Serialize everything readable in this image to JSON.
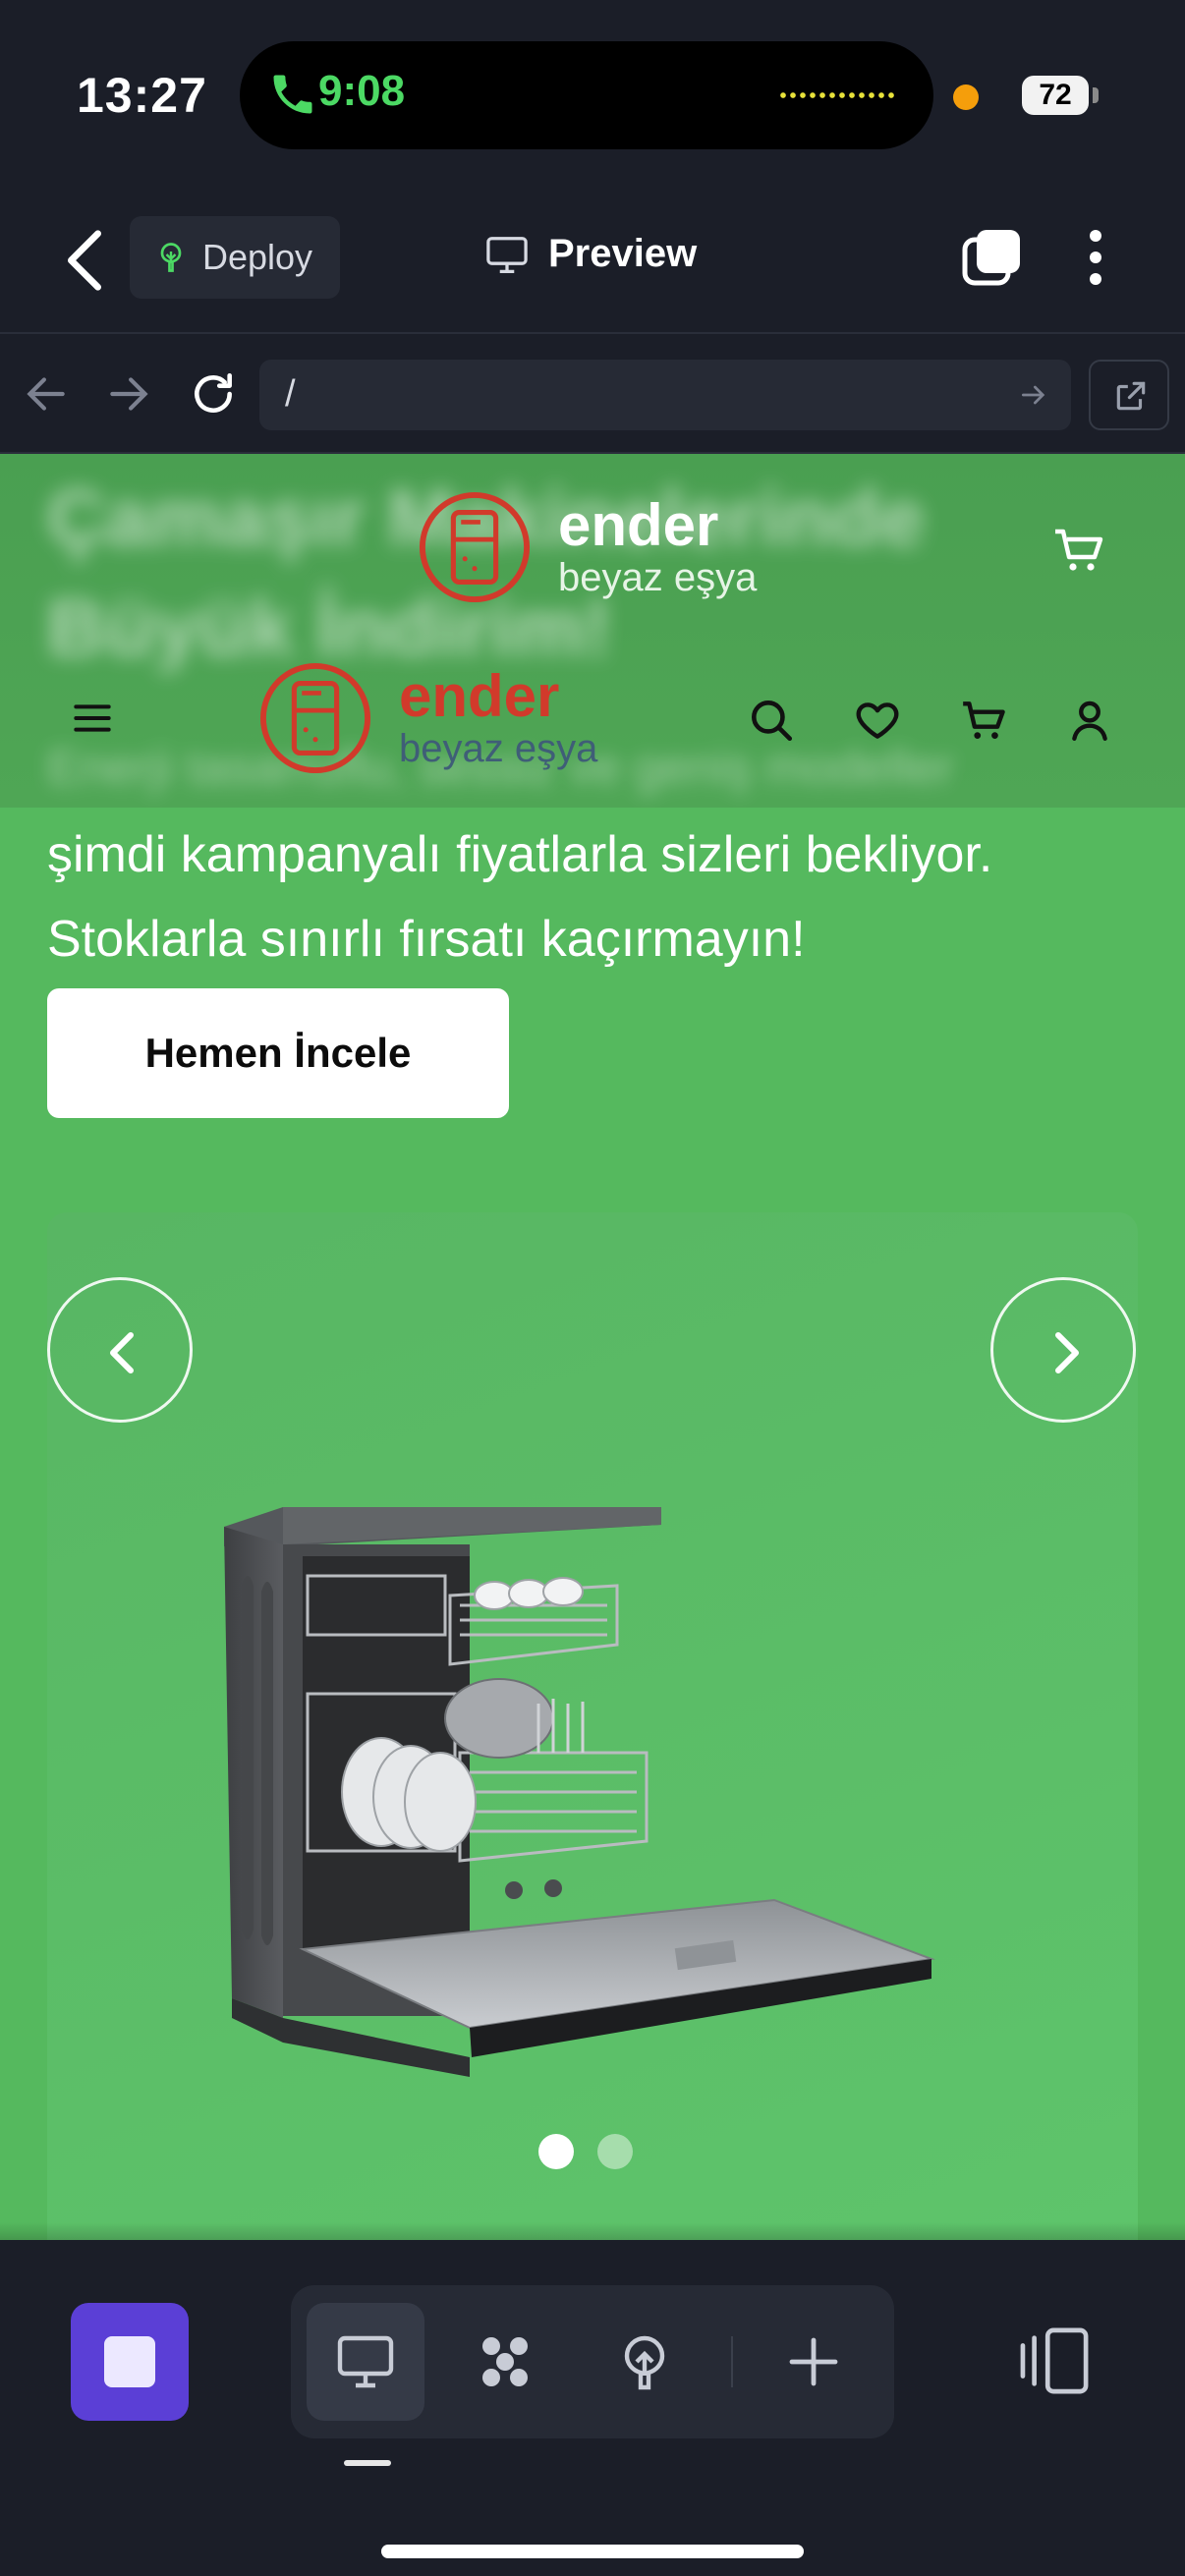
{
  "status_bar": {
    "time": "13:27",
    "call_time": "9:08",
    "battery": "72",
    "colors": {
      "call": "#4cd964",
      "privacy_dot": "#f59e0b"
    }
  },
  "toolbar": {
    "back_icon": "chevron-left-icon",
    "deploy_label": "Deploy",
    "deploy_icon": "tree-icon",
    "preview_label": "Preview",
    "preview_icon": "monitor-icon",
    "tabs_icon": "tabs-icon",
    "more_icon": "more-vertical-icon"
  },
  "browser": {
    "url": "/",
    "back_icon": "arrow-left-icon",
    "forward_icon": "arrow-right-icon",
    "reload_icon": "reload-icon",
    "open_external_icon": "external-link-icon"
  },
  "site": {
    "blurred_heading_lines": [
      "Çamaşır Makinelerinde",
      "Büyük İndirim!"
    ],
    "blurred_subtitle": "Enerji tasarruflu, sessiz ve geniş modeller",
    "logo": {
      "name": "ender",
      "tagline": "beyaz eşya"
    },
    "promo_lines": [
      "şimdi kampanyalı fiyatlarla sizleri bekliyor.",
      "Stoklarla sınırlı fırsatı kaçırmayın!"
    ],
    "cta_label": "Hemen İncele",
    "carousel": {
      "slide_count": 2,
      "active_slide": 1
    },
    "nav_icons": [
      "menu-icon",
      "search-icon",
      "heart-icon",
      "cart-icon",
      "user-icon"
    ],
    "colors": {
      "background": "#55b95e",
      "brand_red": "#d13a2b",
      "tagline_blue": "#3f5e77"
    }
  },
  "bottom_bar": {
    "tools": [
      "monitor-icon",
      "components-icon",
      "deploy-tree-icon",
      "plus-icon"
    ],
    "active_tool": 0,
    "accent": "#5b3fd6"
  }
}
